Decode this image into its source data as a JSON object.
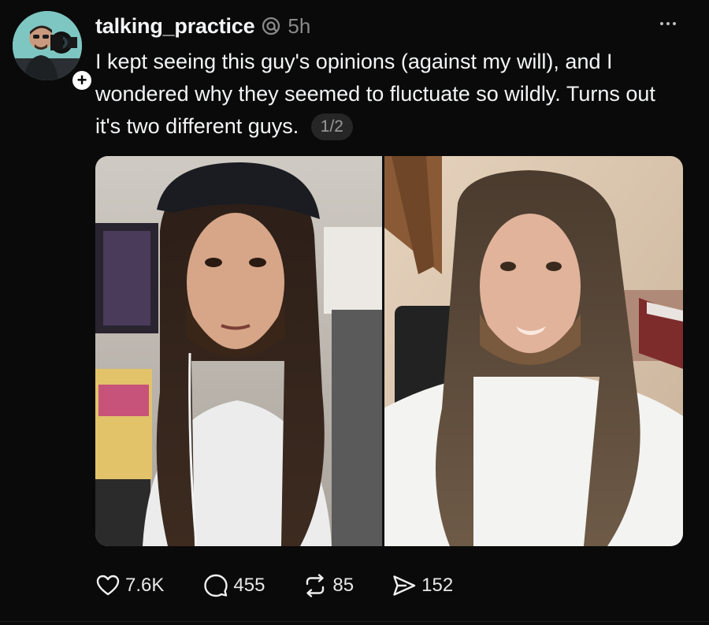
{
  "post": {
    "username": "talking_practice",
    "timestamp": "5h",
    "text": "I kept seeing this guy's opinions (against my will), and I wondered why they seemed to fluctuate so wildly. Turns out it's two different guys.",
    "page_indicator": "1/2"
  },
  "actions": {
    "likes": "7.6K",
    "replies": "455",
    "reposts": "85",
    "shares": "152"
  },
  "icons": {
    "thread": "threads-logo-icon",
    "follow": "plus-icon",
    "more": "more-dots-icon",
    "like": "heart-icon",
    "reply": "speech-bubble-icon",
    "repost": "repost-arrows-icon",
    "share": "send-icon"
  },
  "colors": {
    "background": "#0a0a0a",
    "text": "#f3f5f7",
    "muted": "#8a8a8a",
    "pill": "#262626"
  }
}
